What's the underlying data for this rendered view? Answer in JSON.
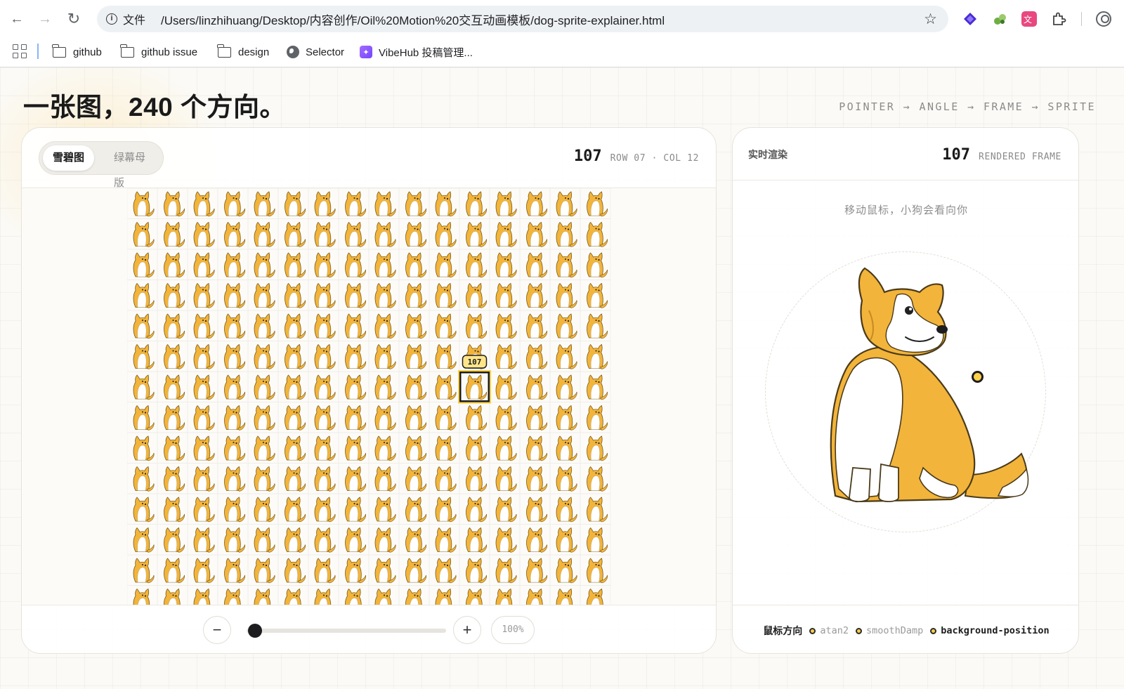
{
  "browser": {
    "omnibox_scheme": "文件",
    "url": "/Users/linzhihuang/Desktop/内容创作/Oil%20Motion%20交互动画模板/dog-sprite-explainer.html",
    "bookmarks": [
      {
        "label": "github",
        "icon": "folder-icon"
      },
      {
        "label": "github issue",
        "icon": "folder-icon"
      },
      {
        "label": "design",
        "icon": "folder-icon"
      },
      {
        "label": "Selector",
        "icon": "globe-icon"
      },
      {
        "label": "VibeHub 投稿管理...",
        "icon": "vibehub-icon"
      }
    ],
    "extensions": [
      {
        "name": "diamond-extension-icon",
        "color": "#4b2bd6"
      },
      {
        "name": "puzzle-green-extension-icon",
        "color": "#6fae45"
      },
      {
        "name": "translate-extension-icon",
        "color": "#e8477f"
      }
    ]
  },
  "page": {
    "title": "一张图，240 个方向。",
    "pipeline": "POINTER → ANGLE → FRAME → SPRITE"
  },
  "sprite_panel": {
    "tabs": [
      {
        "label": "雪碧图",
        "active": true
      },
      {
        "label": "绿幕母版",
        "active": false
      }
    ],
    "frame_number": "107",
    "frame_position": "ROW 07 · COL 12",
    "highlight_badge": "107",
    "highlight_row": 7,
    "highlight_col": 12,
    "grid_rows": 14,
    "grid_cols": 16,
    "zoom": {
      "minus_label": "−",
      "plus_label": "+",
      "value_label": "100%",
      "slider_fraction": 0.0
    }
  },
  "render_panel": {
    "title": "实时渲染",
    "frame_number": "107",
    "frame_caption": "RENDERED FRAME",
    "hint": "移动鼠标，小狗会看向你",
    "pipeline_lead": "鼠标方向",
    "pipeline_steps": [
      {
        "label": "atan2",
        "emphasis": false
      },
      {
        "label": "smoothDamp",
        "emphasis": false
      },
      {
        "label": "background-position",
        "emphasis": true
      }
    ]
  },
  "colors": {
    "accent_yellow": "#ffcf3f",
    "dog_orange": "#f2b43a",
    "ink": "#1d1d1f"
  }
}
